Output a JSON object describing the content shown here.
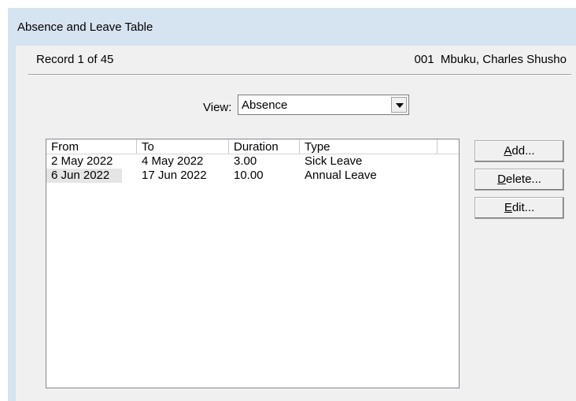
{
  "window": {
    "title": "Absence and Leave Table"
  },
  "record": {
    "position": "Record 1 of 45",
    "employee": "001  Mbuku, Charles Shusho"
  },
  "view": {
    "label": "View:",
    "selected": "Absence"
  },
  "list": {
    "columns": [
      "From",
      "To",
      "Duration",
      "Type",
      ""
    ],
    "rows": [
      [
        "2 May 2022",
        "4 May 2022",
        "3.00",
        "Sick Leave"
      ],
      [
        "6 Jun 2022",
        "17 Jun 2022",
        "10.00",
        "Annual Leave"
      ]
    ]
  },
  "buttons": {
    "add": {
      "mnemonic": "A",
      "rest": "dd..."
    },
    "delete": {
      "mnemonic": "D",
      "rest": "elete..."
    },
    "edit": {
      "mnemonic": "E",
      "rest": "dit..."
    }
  },
  "icons": {
    "dropdown": "chevron-down-icon"
  }
}
